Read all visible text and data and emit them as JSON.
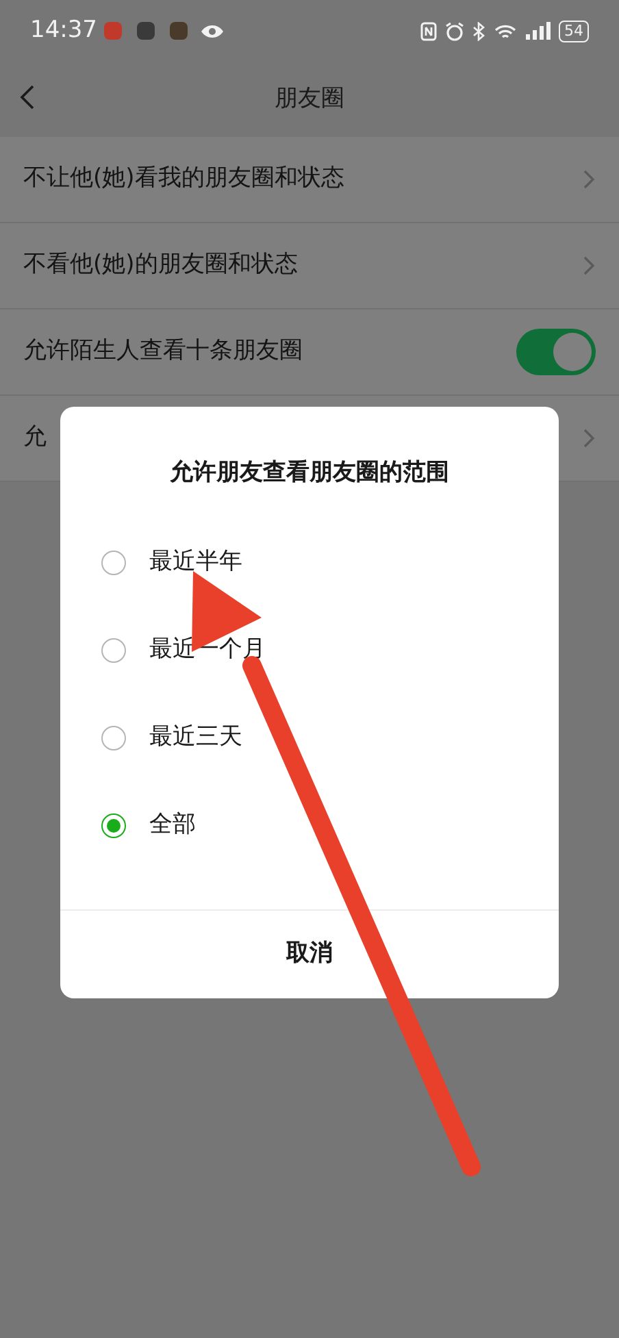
{
  "status_bar": {
    "time": "14:37",
    "battery": "54"
  },
  "header": {
    "title": "朋友圈"
  },
  "rows": [
    {
      "kind": "link",
      "label": "不让他(她)看我的朋友圈和状态"
    },
    {
      "kind": "link",
      "label": "不看他(她)的朋友圈和状态"
    },
    {
      "kind": "toggle",
      "label": "允许陌生人查看十条朋友圈",
      "on": true
    },
    {
      "kind": "link",
      "label": "允"
    }
  ],
  "dialog": {
    "title": "允许朋友查看朋友圈的范围",
    "options": [
      {
        "label": "最近半年",
        "selected": false
      },
      {
        "label": "最近一个月",
        "selected": false
      },
      {
        "label": "最近三天",
        "selected": false
      },
      {
        "label": "全部",
        "selected": true
      }
    ],
    "cancel": "取消"
  }
}
